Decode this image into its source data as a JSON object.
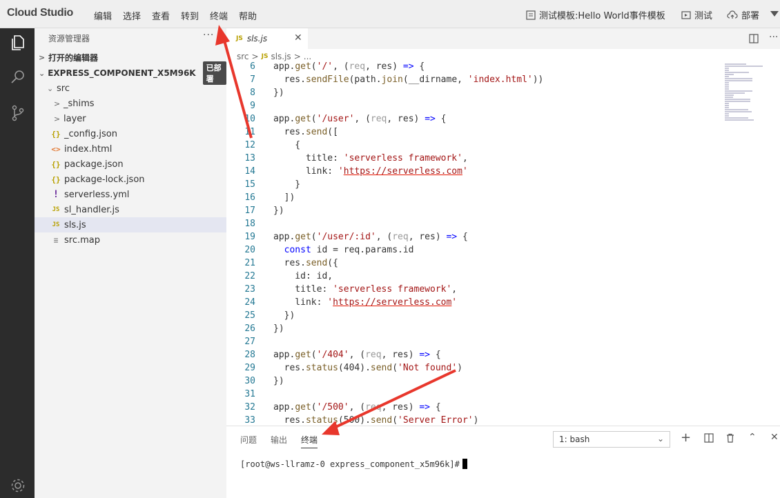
{
  "menubar": {
    "brand": "Cloud Studio",
    "items": [
      "编辑",
      "选择",
      "查看",
      "转到",
      "终端",
      "帮助"
    ],
    "template": "测试模板:Hello World事件模板",
    "test": "测试",
    "deploy": "部署"
  },
  "sidebar": {
    "title": "资源管理器",
    "more": "···",
    "open_editors": "打开的编辑器",
    "project": "EXPRESS_COMPONENT_X5M96K",
    "deploy_badge": "已部署",
    "folder_src": "src",
    "items": [
      {
        "name": "_shims",
        "icon": "folder-chevron"
      },
      {
        "name": "layer",
        "icon": "folder-chevron"
      },
      {
        "name": "_config.json",
        "icon": "json-icon"
      },
      {
        "name": "index.html",
        "icon": "html-icon"
      },
      {
        "name": "package.json",
        "icon": "json-icon"
      },
      {
        "name": "package-lock.json",
        "icon": "json-icon"
      },
      {
        "name": "serverless.yml",
        "icon": "yaml-icon"
      },
      {
        "name": "sl_handler.js",
        "icon": "js-icon"
      },
      {
        "name": "sls.js",
        "icon": "js-icon"
      },
      {
        "name": "src.map",
        "icon": "file-icon"
      }
    ]
  },
  "editor": {
    "tab_label": "sls.js",
    "tab_icon": "JS",
    "breadcrumb": [
      "src",
      "sls.js",
      "..."
    ],
    "lines": [
      {
        "n": "6",
        "t": "app.get('/', (req, res) => {"
      },
      {
        "n": "7",
        "t": "  res.sendFile(path.join(__dirname, 'index.html'))"
      },
      {
        "n": "8",
        "t": "})"
      },
      {
        "n": "9",
        "t": ""
      },
      {
        "n": "10",
        "t": "app.get('/user', (req, res) => {"
      },
      {
        "n": "11",
        "t": "  res.send(["
      },
      {
        "n": "12",
        "t": "    {"
      },
      {
        "n": "13",
        "t": "      title: 'serverless framework',"
      },
      {
        "n": "14",
        "t": "      link: 'https://serverless.com'"
      },
      {
        "n": "15",
        "t": "    }"
      },
      {
        "n": "16",
        "t": "  ])"
      },
      {
        "n": "17",
        "t": "})"
      },
      {
        "n": "18",
        "t": ""
      },
      {
        "n": "19",
        "t": "app.get('/user/:id', (req, res) => {"
      },
      {
        "n": "20",
        "t": "  const id = req.params.id"
      },
      {
        "n": "21",
        "t": "  res.send({"
      },
      {
        "n": "22",
        "t": "    id: id,"
      },
      {
        "n": "23",
        "t": "    title: 'serverless framework',"
      },
      {
        "n": "24",
        "t": "    link: 'https://serverless.com'"
      },
      {
        "n": "25",
        "t": "  })"
      },
      {
        "n": "26",
        "t": "})"
      },
      {
        "n": "27",
        "t": ""
      },
      {
        "n": "28",
        "t": "app.get('/404', (req, res) => {"
      },
      {
        "n": "29",
        "t": "  res.status(404).send('Not found')"
      },
      {
        "n": "30",
        "t": "})"
      },
      {
        "n": "31",
        "t": ""
      },
      {
        "n": "32",
        "t": "app.get('/500', (req, res) => {"
      },
      {
        "n": "33",
        "t": "  res.status(500).send('Server Error')"
      }
    ]
  },
  "panel": {
    "tabs": [
      "问题",
      "输出",
      "终端"
    ],
    "terminal_select": "1: bash",
    "prompt": "[root@ws-llramz-0 express_component_x5m96k]#"
  },
  "colors": {
    "activity_bar": "#2c2c2c",
    "sidebar_bg": "#f3f3f3",
    "annotation_arrow": "#e8372c"
  }
}
